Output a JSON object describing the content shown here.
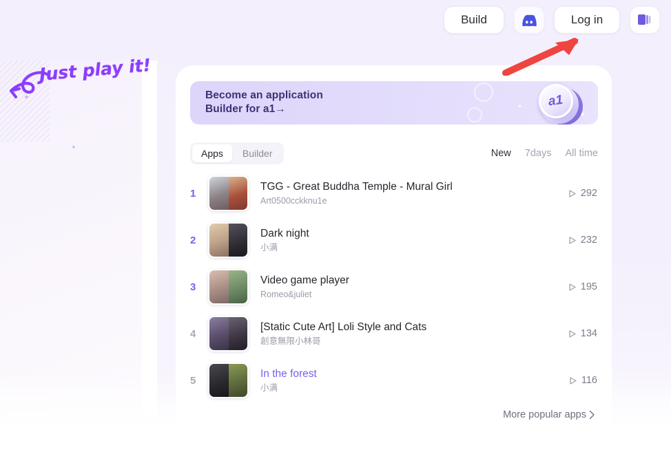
{
  "header": {
    "build_label": "Build",
    "discord_icon": "discord-icon",
    "login_label": "Log in",
    "library_icon": "library-stack-icon"
  },
  "banner": {
    "line1": "Become an application",
    "line2": "Builder for a1→",
    "logo_glyph": "a1"
  },
  "toolbar": {
    "tabs": [
      {
        "label": "Apps",
        "active": true
      },
      {
        "label": "Builder",
        "active": false
      }
    ],
    "filters": [
      {
        "label": "New",
        "active": true
      },
      {
        "label": "7days",
        "active": false
      },
      {
        "label": "All time",
        "active": false
      }
    ]
  },
  "list": {
    "items": [
      {
        "rank": "1",
        "title": "TGG - Great Buddha Temple - Mural Girl",
        "author": "Art0500cckknu1e",
        "plays": "292",
        "highlighted": false,
        "rank_dim": false,
        "thumb_left": "#8e8388",
        "thumb_right": "#a8503d"
      },
      {
        "rank": "2",
        "title": "Dark night",
        "author": "小满",
        "plays": "232",
        "highlighted": false,
        "rank_dim": false,
        "thumb_left": "#bca188",
        "thumb_right": "#2e2b33"
      },
      {
        "rank": "3",
        "title": "Video game player",
        "author": "Romeo&juliet",
        "plays": "195",
        "highlighted": false,
        "rank_dim": false,
        "thumb_left": "#a98e84",
        "thumb_right": "#6c8a66"
      },
      {
        "rank": "4",
        "title": "[Static Cute Art] Loli Style and Cats",
        "author": "創意無限小林哥",
        "plays": "134",
        "highlighted": false,
        "rank_dim": true,
        "thumb_left": "#5a4e6b",
        "thumb_right": "#3a3340"
      },
      {
        "rank": "5",
        "title": "In the forest",
        "author": "小满",
        "plays": "116",
        "highlighted": true,
        "rank_dim": true,
        "thumb_left": "#2b2a2e",
        "thumb_right": "#5d6b3c"
      }
    ],
    "more_label": "More popular apps",
    "more_chevron": "chevron-right-icon",
    "play_icon": "play-triangle-icon"
  },
  "annotations": {
    "play_text": "Just play it!",
    "left_arrow_icon": "curved-arrow-left-icon",
    "red_arrow_icon": "arrow-up-right-icon",
    "accent_purple": "#8b3dff",
    "accent_red": "#f04440"
  }
}
